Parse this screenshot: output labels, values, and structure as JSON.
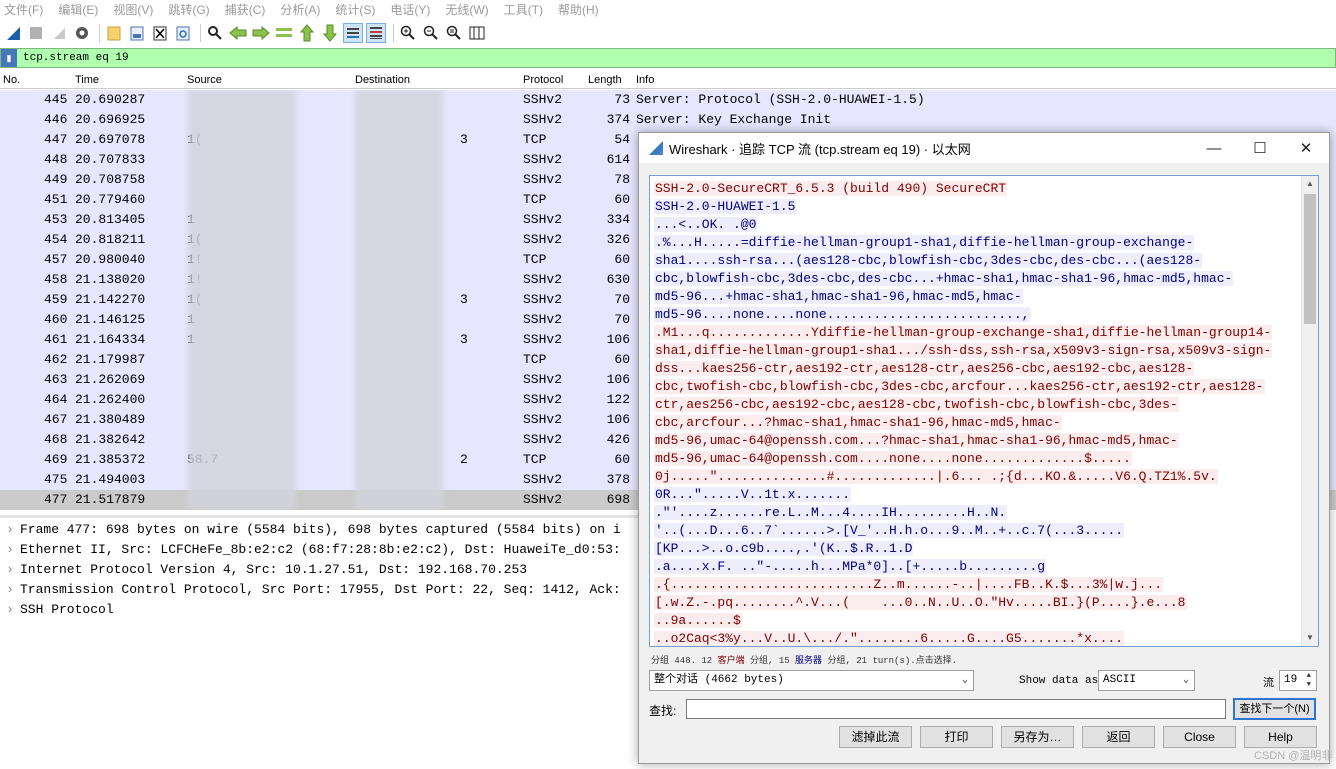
{
  "menubar": [
    "文件(F)",
    "编辑(E)",
    "视图(V)",
    "跳转(G)",
    "捕获(C)",
    "分析(A)",
    "统计(S)",
    "电话(Y)",
    "无线(W)",
    "工具(T)",
    "帮助(H)"
  ],
  "toolbar_icons": [
    "shark-fin-icon",
    "stop-icon",
    "restart-icon",
    "options-gear-icon",
    "open-file-icon",
    "save-file-icon",
    "close-file-icon",
    "reload-icon",
    "find-packet-icon",
    "go-back-icon",
    "go-forward-icon",
    "go-to-packet-icon",
    "go-first-icon",
    "go-last-icon",
    "autoscroll-icon",
    "colorize-icon",
    "zoom-in-icon",
    "zoom-out-icon",
    "zoom-normal-icon",
    "resize-columns-icon"
  ],
  "filter": {
    "text": "tcp.stream eq 19"
  },
  "columns": {
    "no": "No.",
    "time": "Time",
    "source": "Source",
    "destination": "Destination",
    "protocol": "Protocol",
    "length": "Length",
    "info": "Info"
  },
  "packets": [
    {
      "no": "445",
      "time": "20.690287",
      "src": "",
      "dst": "",
      "proto": "SSHv2",
      "len": "73",
      "info": "Server: Protocol (SSH-2.0-HUAWEI-1.5)"
    },
    {
      "no": "446",
      "time": "20.696925",
      "src": "",
      "dst": "",
      "proto": "SSHv2",
      "len": "374",
      "info": "Server: Key Exchange Init"
    },
    {
      "no": "447",
      "time": "20.697078",
      "src": "1(",
      "dst": "3",
      "proto": "TCP",
      "len": "54",
      "info": ""
    },
    {
      "no": "448",
      "time": "20.707833",
      "src": "",
      "dst": "",
      "proto": "SSHv2",
      "len": "614",
      "info": ""
    },
    {
      "no": "449",
      "time": "20.708758",
      "src": "",
      "dst": "",
      "proto": "SSHv2",
      "len": "78",
      "info": ""
    },
    {
      "no": "451",
      "time": "20.779460",
      "src": "",
      "dst": "",
      "proto": "TCP",
      "len": "60",
      "info": ""
    },
    {
      "no": "453",
      "time": "20.813405",
      "src": "1",
      "dst": "",
      "proto": "SSHv2",
      "len": "334",
      "info": ""
    },
    {
      "no": "454",
      "time": "20.818211",
      "src": "1(",
      "dst": "",
      "proto": "SSHv2",
      "len": "326",
      "info": ""
    },
    {
      "no": "457",
      "time": "20.980040",
      "src": "1!",
      "dst": "",
      "proto": "TCP",
      "len": "60",
      "info": ""
    },
    {
      "no": "458",
      "time": "21.138020",
      "src": "1!",
      "dst": "",
      "proto": "SSHv2",
      "len": "630",
      "info": ""
    },
    {
      "no": "459",
      "time": "21.142270",
      "src": "1(",
      "dst": "3",
      "proto": "SSHv2",
      "len": "70",
      "info": ""
    },
    {
      "no": "460",
      "time": "21.146125",
      "src": "1",
      "dst": "",
      "proto": "SSHv2",
      "len": "70",
      "info": ""
    },
    {
      "no": "461",
      "time": "21.164334",
      "src": "1",
      "dst": "3",
      "proto": "SSHv2",
      "len": "106",
      "info": ""
    },
    {
      "no": "462",
      "time": "21.179987",
      "src": "",
      "dst": "",
      "proto": "TCP",
      "len": "60",
      "info": ""
    },
    {
      "no": "463",
      "time": "21.262069",
      "src": "",
      "dst": "",
      "proto": "SSHv2",
      "len": "106",
      "info": ""
    },
    {
      "no": "464",
      "time": "21.262400",
      "src": "",
      "dst": "",
      "proto": "SSHv2",
      "len": "122",
      "info": ""
    },
    {
      "no": "467",
      "time": "21.380489",
      "src": "",
      "dst": "",
      "proto": "SSHv2",
      "len": "106",
      "info": ""
    },
    {
      "no": "468",
      "time": "21.382642",
      "src": "",
      "dst": "",
      "proto": "SSHv2",
      "len": "426",
      "info": ""
    },
    {
      "no": "469",
      "time": "21.385372",
      "src": "58.7",
      "dst": "2",
      "proto": "TCP",
      "len": "60",
      "info": ""
    },
    {
      "no": "475",
      "time": "21.494003",
      "src": "",
      "dst": "",
      "proto": "SSHv2",
      "len": "378",
      "info": ""
    },
    {
      "no": "477",
      "time": "21.517879",
      "src": "",
      "dst": "",
      "proto": "SSHv2",
      "len": "698",
      "info": ""
    }
  ],
  "details": [
    "Frame 477: 698 bytes on wire (5584 bits), 698 bytes captured (5584 bits) on i",
    "Ethernet II, Src: LCFCHeFe_8b:e2:c2 (68:f7:28:8b:e2:c2), Dst: HuaweiTe_d0:53:",
    "Internet Protocol Version 4, Src: 10.1.27.51, Dst: 192.168.70.253",
    "Transmission Control Protocol, Src Port: 17955, Dst Port: 22, Seq: 1412, Ack:",
    "SSH Protocol"
  ],
  "dialog": {
    "title": "Wireshark · 追踪 TCP 流 (tcp.stream eq 19) · 以太网",
    "minimize": "—",
    "maximize": "☐",
    "close": "✕",
    "stream_lines": [
      {
        "t": "c",
        "text": "SSH-2.0-SecureCRT_6.5.3 (build 490) SecureCRT"
      },
      {
        "t": "s",
        "text": "SSH-2.0-HUAWEI-1.5"
      },
      {
        "t": "s",
        "text": "...<..OK. .@0"
      },
      {
        "t": "s",
        "text": ".%...H.....=diffie-hellman-group1-sha1,diffie-hellman-group-exchange-"
      },
      {
        "t": "s",
        "text": "sha1....ssh-rsa...(aes128-cbc,blowfish-cbc,3des-cbc,des-cbc...(aes128-"
      },
      {
        "t": "s",
        "text": "cbc,blowfish-cbc,3des-cbc,des-cbc...+hmac-sha1,hmac-sha1-96,hmac-md5,hmac-"
      },
      {
        "t": "s",
        "text": "md5-96...+hmac-sha1,hmac-sha1-96,hmac-md5,hmac-"
      },
      {
        "t": "s",
        "text": "md5-96....none....none.........................,"
      },
      {
        "t": "c",
        "text": ".M1...q.............Ydiffie-hellman-group-exchange-sha1,diffie-hellman-group14-"
      },
      {
        "t": "c",
        "text": "sha1,diffie-hellman-group1-sha1.../ssh-dss,ssh-rsa,x509v3-sign-rsa,x509v3-sign-"
      },
      {
        "t": "c",
        "text": "dss...kaes256-ctr,aes192-ctr,aes128-ctr,aes256-cbc,aes192-cbc,aes128-"
      },
      {
        "t": "c",
        "text": "cbc,twofish-cbc,blowfish-cbc,3des-cbc,arcfour...kaes256-ctr,aes192-ctr,aes128-"
      },
      {
        "t": "c",
        "text": "ctr,aes256-cbc,aes192-cbc,aes128-cbc,twofish-cbc,blowfish-cbc,3des-"
      },
      {
        "t": "c",
        "text": "cbc,arcfour...?hmac-sha1,hmac-sha1-96,hmac-md5,hmac-"
      },
      {
        "t": "c",
        "text": "md5-96,umac-64@openssh.com...?hmac-sha1,hmac-sha1-96,hmac-md5,hmac-"
      },
      {
        "t": "c",
        "text": "md5-96,umac-64@openssh.com....none....none.............$....."
      },
      {
        "t": "c",
        "text": "0j.....\"..............#.............|.6... .;{d...KO.&.....V6.Q.TZ1%.5v."
      },
      {
        "t": "s",
        "text": "0R...\".....V..1t.x......."
      },
      {
        "t": "s",
        "text": ".\"'....z......re.L..M...4....IH.........H..N."
      },
      {
        "t": "s",
        "text": "'..(...D...6..7`......>.[V_'..H.h.o...9..M..+..c.7(...3....."
      },
      {
        "t": "s",
        "text": "[KP...>..o.c9b....,.'(K..$.R..1.D"
      },
      {
        "t": "s",
        "text": ".a....x.F. ..\"-.....h...MPa*0]..[+.....b.........g"
      },
      {
        "t": "c",
        "text": ".{..........................Z..m......-..|....FB..K.$...3%|w.j..."
      },
      {
        "t": "c",
        "text": "[.w.Z.-.pq........^.V...(    ...0..N..U..O.\"Hv.....BI.}(P....}.e...8"
      },
      {
        "t": "c",
        "text": "..9a......$"
      },
      {
        "t": "c",
        "text": "..o2Caq<3%y...V..U.\\.../.\"........6.....G....G5.......*x...."
      }
    ],
    "summary_pre": "分组 448. 12 ",
    "summary_client": "客户端",
    "summary_mid": " 分组, 15 ",
    "summary_server": "服务器",
    "summary_post": " 分组, 21 turn(s).点击选择.",
    "conversation_select": "整个对话 (4662 bytes)",
    "show_data_label": "Show data as",
    "show_data_value": "ASCII",
    "stream_label": "流",
    "stream_value": "19",
    "find_label": "查找:",
    "find_value": "",
    "find_next": "查找下一个(N)",
    "buttons": {
      "filter_out": "滤掉此流",
      "print": "打印",
      "save_as": "另存为…",
      "back": "返回",
      "close": "Close",
      "help": "Help"
    }
  },
  "watermark": "CSDN @温明非"
}
